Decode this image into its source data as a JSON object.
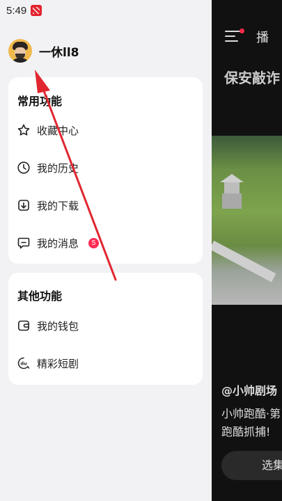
{
  "status_bar": {
    "time": "5:49"
  },
  "profile": {
    "username": "一休ll8"
  },
  "common_functions": {
    "title": "常用功能",
    "items": [
      {
        "label": "收藏中心",
        "icon": "star-icon"
      },
      {
        "label": "我的历史",
        "icon": "clock-icon"
      },
      {
        "label": "我的下载",
        "icon": "download-icon"
      },
      {
        "label": "我的消息",
        "icon": "message-icon",
        "badge": "5"
      }
    ]
  },
  "other_functions": {
    "title": "其他功能",
    "items": [
      {
        "label": "我的钱包",
        "icon": "wallet-icon"
      },
      {
        "label": "精彩短剧",
        "icon": "short-drama-icon"
      }
    ]
  },
  "background_page": {
    "tab_label": "播",
    "video_title": "保安敲诈",
    "author": "@小帅剧场",
    "description_line1": "小帅跑酷·第",
    "description_line2": "跑酷抓捕!",
    "button_label": "选集"
  },
  "colors": {
    "accent_red": "#e0262f",
    "badge_red": "#ff2b55"
  }
}
